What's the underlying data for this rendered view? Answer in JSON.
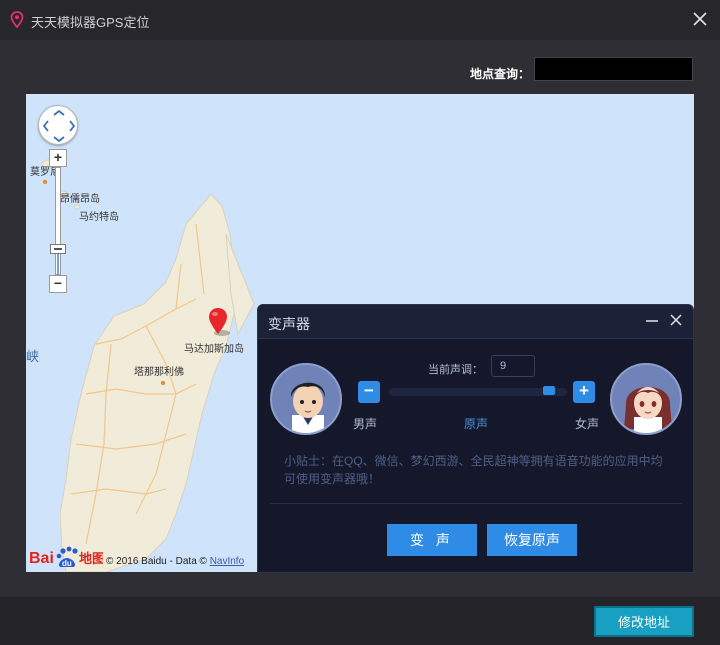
{
  "window": {
    "title": "天天模拟器GPS定位",
    "close_icon": "close-icon"
  },
  "search": {
    "label": "地点查询：",
    "value": "",
    "placeholder": ""
  },
  "map": {
    "labels": {
      "moroni": "莫罗尼",
      "comoros": "昂儒昂岛",
      "mayotte": "马约特岛",
      "madagascar": "马达加斯加岛",
      "antananarivo": "塔那那利佛",
      "strait": "峡"
    },
    "zoom_in_label": "+",
    "zoom_out_label": "−",
    "logo_text_bai": "Bai",
    "logo_text_du": "du",
    "logo_text_map": "地图",
    "copyright_text": "© 2016 Baidu - Data © ",
    "copyright_link": "NavInfo"
  },
  "voice_changer": {
    "title": "变声器",
    "pitch_label": "当前声调：",
    "pitch_value": "9",
    "minus_label": "−",
    "plus_label": "+",
    "male_label": "男声",
    "original_label": "原声",
    "female_label": "女声",
    "tip": "小贴士：在QQ、微信、梦幻西游、全民超神等拥有语音功能的应用中均可使用变声器哦！",
    "change_button": "变 声",
    "restore_button": "恢复原声",
    "accent_color": "#2e8be6"
  },
  "footer": {
    "modify_button": "修改地址",
    "accent_color": "#17a0c2"
  }
}
